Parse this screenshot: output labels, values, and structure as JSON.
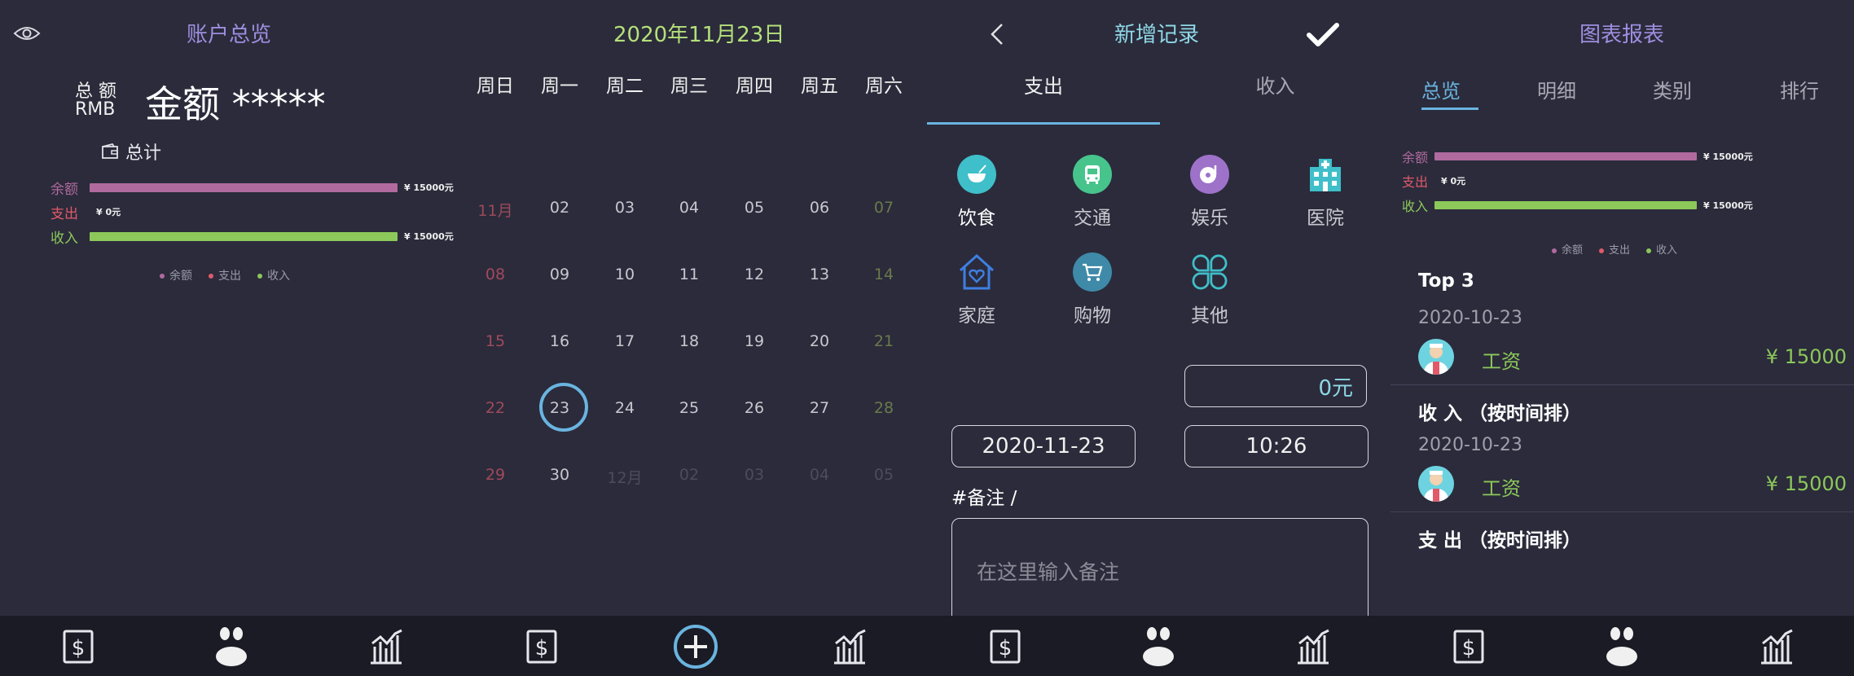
{
  "colors": {
    "balance": "#b06a9e",
    "expense": "#e05a6a",
    "income": "#8cc85a",
    "accent_blue": "#6ab4e0",
    "title_purple": "#9f8ee0",
    "title_green": "#b4e07a",
    "title_cyan": "#8fd8e6"
  },
  "panel1": {
    "title": "账户总览",
    "total_label": "总 额",
    "currency": "RMB",
    "amount": "金额 *****",
    "summary_label": "总计",
    "bars": [
      {
        "label": "余额",
        "value_text": "¥ 15000元",
        "fraction": 1.0
      },
      {
        "label": "支出",
        "value_text": "¥ 0元",
        "fraction": 0.0
      },
      {
        "label": "收入",
        "value_text": "¥ 15000元",
        "fraction": 1.0
      }
    ],
    "legend": [
      "余额",
      "支出",
      "收入"
    ]
  },
  "panel2": {
    "title": "2020年11月23日",
    "weekdays": [
      "周日",
      "周一",
      "周二",
      "周三",
      "周四",
      "周五",
      "周六"
    ],
    "weeks": [
      [
        "11月",
        "02",
        "03",
        "04",
        "05",
        "06",
        "07"
      ],
      [
        "08",
        "09",
        "10",
        "11",
        "12",
        "13",
        "14"
      ],
      [
        "15",
        "16",
        "17",
        "18",
        "19",
        "20",
        "21"
      ],
      [
        "22",
        "23",
        "24",
        "25",
        "26",
        "27",
        "28"
      ],
      [
        "29",
        "30",
        "12月",
        "02",
        "03",
        "04",
        "05"
      ]
    ],
    "selected": "23"
  },
  "panel3": {
    "title": "新增记录",
    "tabs": [
      "支出",
      "收入"
    ],
    "categories": [
      {
        "label": "饮食",
        "icon": "bowl-icon"
      },
      {
        "label": "交通",
        "icon": "bus-icon"
      },
      {
        "label": "娱乐",
        "icon": "music-disc-icon"
      },
      {
        "label": "医院",
        "icon": "hospital-icon"
      },
      {
        "label": "家庭",
        "icon": "home-heart-icon"
      },
      {
        "label": "购物",
        "icon": "cart-icon"
      },
      {
        "label": "其他",
        "icon": "clover-icon"
      }
    ],
    "amount_value": "0元",
    "date_value": "2020-11-23",
    "time_value": "10:26",
    "note_label": "#备注 /",
    "note_placeholder": "在这里输入备注"
  },
  "panel4": {
    "title": "图表报表",
    "tabs": [
      "总览",
      "明细",
      "类别",
      "排行"
    ],
    "bars": [
      {
        "label": "余额",
        "value_text": "¥ 15000元",
        "fraction": 1.0
      },
      {
        "label": "支出",
        "value_text": "¥ 0元",
        "fraction": 0.0
      },
      {
        "label": "收入",
        "value_text": "¥ 15000元",
        "fraction": 1.0
      }
    ],
    "legend": [
      "余额",
      "支出",
      "收入"
    ],
    "top3_title": "Top 3",
    "top3_date": "2020-10-23",
    "top3_item": {
      "name": "工资",
      "amount": "¥ 15000"
    },
    "income_title": "收 入 （按时间排）",
    "income_date": "2020-10-23",
    "income_item": {
      "name": "工资",
      "amount": "¥ 15000"
    },
    "expense_title": "支 出 （按时间排）"
  }
}
